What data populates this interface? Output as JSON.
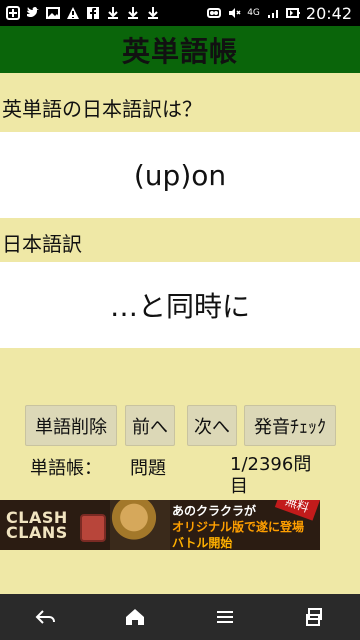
{
  "statusbar": {
    "time": "20:42",
    "network": "4G",
    "left_icons": [
      "add-icon",
      "twitter-icon",
      "image-icon",
      "warning-icon",
      "facebook-icon",
      "download-icon",
      "download-icon",
      "download-icon"
    ],
    "right_icons": [
      "recording-icon",
      "mute-icon",
      "signal-icon",
      "battery-icon"
    ]
  },
  "header": {
    "title": "英単語帳"
  },
  "main": {
    "question_label": "英単語の日本語訳は？",
    "word": "(up)on",
    "answer_label": "日本語訳",
    "answer": "…と同時に"
  },
  "buttons": {
    "delete": "単語削除",
    "prev": "前へ",
    "next": "次へ",
    "pronounce": "発音ﾁｪｯｸ"
  },
  "stats": {
    "label": "単語帳：",
    "mode": "問題",
    "progress_line1": "1/2396問",
    "progress_line2": "目"
  },
  "ad": {
    "logo_line1": "CLASH",
    "logo_line2": "CLANS",
    "text1": "あのクラクラが",
    "text2": "オリジナル版で遂に登場",
    "text3": "バトル開始",
    "badge": "無料"
  },
  "navbar": {
    "items": [
      "back-icon",
      "home-icon",
      "menu-icon",
      "recent-apps-icon"
    ]
  }
}
